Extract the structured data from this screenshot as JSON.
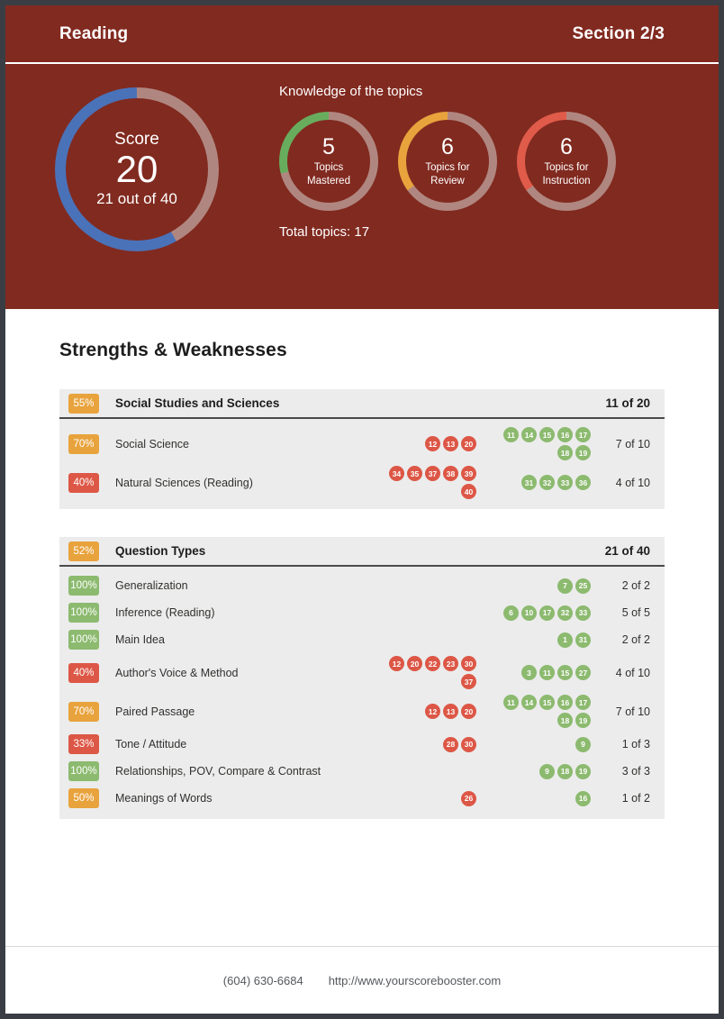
{
  "header": {
    "title": "Reading",
    "section": "Section 2/3"
  },
  "score": {
    "label": "Score",
    "value": "20",
    "sub": "21 out of 40",
    "percent": 58,
    "arc_color": "#4a72b8",
    "track_color": "#b08780"
  },
  "topics": {
    "heading": "Knowledge of the topics",
    "total_label": "Total topics: 17",
    "items": [
      {
        "number": "5",
        "caption_line1": "Topics",
        "caption_line2": "Mastered",
        "percent": 29,
        "color": "#68ad5e"
      },
      {
        "number": "6",
        "caption_line1": "Topics for",
        "caption_line2": "Review",
        "percent": 35,
        "color": "#e8a33d"
      },
      {
        "number": "6",
        "caption_line1": "Topics for",
        "caption_line2": "Instruction",
        "percent": 35,
        "color": "#e05b4a"
      }
    ]
  },
  "main": {
    "section_title": "Strengths & Weaknesses",
    "tables": [
      {
        "header": {
          "pill": "55%",
          "pill_color": "orange",
          "title": "Social Studies and Sciences",
          "score": "11 of 20"
        },
        "rows": [
          {
            "pill": "70%",
            "pill_color": "orange",
            "label": "Social Science",
            "wrong": [
              "12",
              "13",
              "20"
            ],
            "right": [
              "11",
              "14",
              "15",
              "16",
              "17",
              "18",
              "19"
            ],
            "score": "7 of 10"
          },
          {
            "pill": "40%",
            "pill_color": "red",
            "label": "Natural Sciences (Reading)",
            "wrong": [
              "34",
              "35",
              "37",
              "38",
              "39",
              "40"
            ],
            "right": [
              "31",
              "32",
              "33",
              "36"
            ],
            "score": "4 of 10"
          }
        ]
      },
      {
        "header": {
          "pill": "52%",
          "pill_color": "orange",
          "title": "Question Types",
          "score": "21 of 40"
        },
        "rows": [
          {
            "pill": "100%",
            "pill_color": "green",
            "label": "Generalization",
            "wrong": [],
            "right": [
              "7",
              "25"
            ],
            "score": "2 of 2"
          },
          {
            "pill": "100%",
            "pill_color": "green",
            "label": "Inference (Reading)",
            "wrong": [],
            "right": [
              "6",
              "10",
              "17",
              "32",
              "33"
            ],
            "score": "5 of 5"
          },
          {
            "pill": "100%",
            "pill_color": "green",
            "label": "Main Idea",
            "wrong": [],
            "right": [
              "1",
              "31"
            ],
            "score": "2 of 2"
          },
          {
            "pill": "40%",
            "pill_color": "red",
            "label": "Author's Voice & Method",
            "wrong": [
              "12",
              "20",
              "22",
              "23",
              "30",
              "37"
            ],
            "right": [
              "3",
              "11",
              "15",
              "27"
            ],
            "score": "4 of 10"
          },
          {
            "pill": "70%",
            "pill_color": "orange",
            "label": "Paired Passage",
            "wrong": [
              "12",
              "13",
              "20"
            ],
            "right": [
              "11",
              "14",
              "15",
              "16",
              "17",
              "18",
              "19"
            ],
            "score": "7 of 10"
          },
          {
            "pill": "33%",
            "pill_color": "red",
            "label": "Tone / Attitude",
            "wrong": [
              "28",
              "30"
            ],
            "right": [
              "9"
            ],
            "score": "1 of 3"
          },
          {
            "pill": "100%",
            "pill_color": "green",
            "label": "Relationships, POV, Compare & Contrast",
            "wrong": [],
            "right": [
              "9",
              "18",
              "19"
            ],
            "score": "3 of 3"
          },
          {
            "pill": "50%",
            "pill_color": "orange",
            "label": "Meanings of Words",
            "wrong": [
              "26"
            ],
            "right": [
              "16"
            ],
            "score": "1 of 2"
          }
        ]
      }
    ]
  },
  "footer": {
    "phone": "(604) 630-6684",
    "website": "http://www.yourscorebooster.com"
  }
}
